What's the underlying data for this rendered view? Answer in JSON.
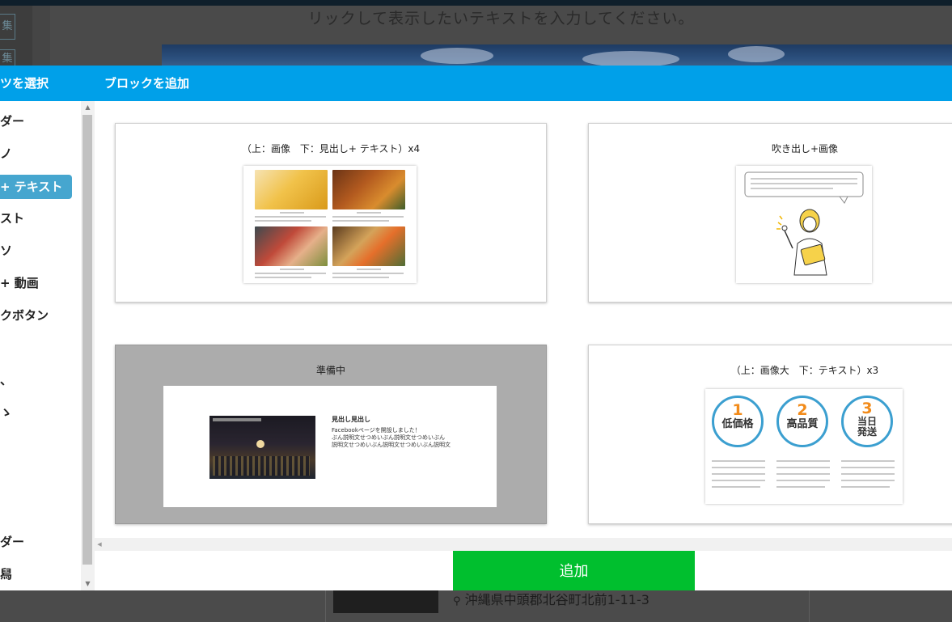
{
  "background": {
    "header_text": "リックして表示したいテキストを入力してください。",
    "address": "沖縄県中頭郡北谷町北前1-11-3",
    "left_buttons": [
      "集",
      "集"
    ]
  },
  "modal": {
    "left_header": "ツを選択",
    "title": "ブロックを追加",
    "add_button": "追加"
  },
  "sidebar": {
    "items": [
      {
        "label": "ダー",
        "active": false
      },
      {
        "label": "ノ",
        "active": false
      },
      {
        "label": "+ テキスト",
        "active": true
      },
      {
        "label": "スト",
        "active": false
      },
      {
        "label": "ソ",
        "active": false
      },
      {
        "label": "+ 動画",
        "active": false
      },
      {
        "label": "クボタン",
        "active": false
      },
      {
        "label": "、",
        "active": false
      },
      {
        "label": "ゝ",
        "active": false
      },
      {
        "label": "ダー",
        "active": false
      },
      {
        "label": "舄",
        "active": false
      }
    ]
  },
  "blocks": [
    {
      "title": "（上：画像　下：見出し+ テキスト）x4",
      "disabled": false
    },
    {
      "title": "吹き出し+画像",
      "disabled": false
    },
    {
      "title": "準備中",
      "disabled": true
    },
    {
      "title": "（上：画像大　下：テキスト）x3",
      "disabled": false
    }
  ],
  "preview_video": {
    "heading": "見出し見出し",
    "text_1": "Facebookページを開設しました！",
    "text_2": "ぶん説明文せつめいぶん説明文せつめいぶん",
    "text_3": "説明文せつめいぶん説明文せつめいぶん説明文"
  },
  "preview_features": [
    {
      "number": "1",
      "label_1": "低価格",
      "label_2": ""
    },
    {
      "number": "2",
      "label_1": "高品質",
      "label_2": ""
    },
    {
      "number": "3",
      "label_1": "当日",
      "label_2": "発送"
    }
  ],
  "colors": {
    "header_blue": "#00a0e9",
    "active_item": "#46a6cf",
    "add_green": "#00bf2e",
    "circle_blue": "#3b9fd0",
    "circle_number": "#f28b1a"
  },
  "icons": {
    "scroll_up": "▲",
    "scroll_down": "▼",
    "scroll_left": "◀",
    "map_pin": "📍"
  }
}
